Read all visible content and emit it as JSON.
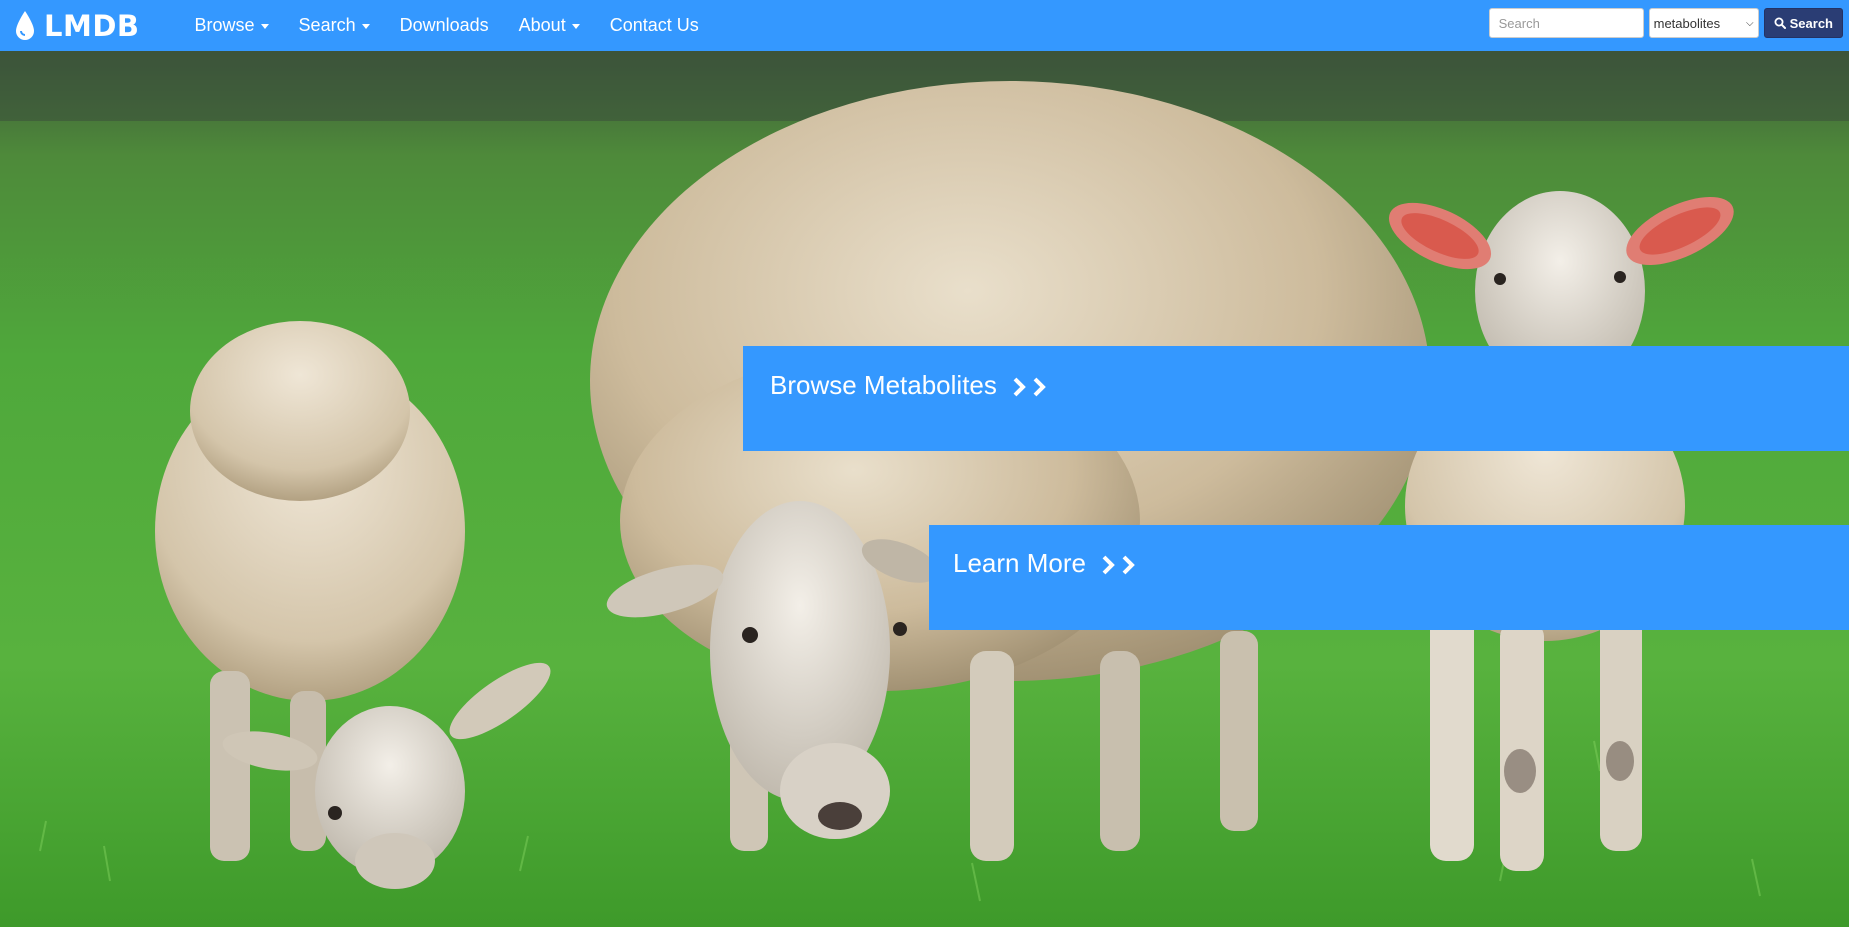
{
  "navbar": {
    "brand": "LMDB",
    "brand_icon": "droplet-icon",
    "items": [
      {
        "label": "Browse",
        "dropdown": true
      },
      {
        "label": "Search",
        "dropdown": true
      },
      {
        "label": "Downloads",
        "dropdown": false
      },
      {
        "label": "About",
        "dropdown": true
      },
      {
        "label": "Contact Us",
        "dropdown": false
      }
    ],
    "search": {
      "placeholder": "Search",
      "value": "",
      "selected_option": "metabolites",
      "button_label": "Search",
      "button_icon": "search-icon"
    },
    "colors": {
      "bar": "#3498ff",
      "search_button": "#2a3d74"
    }
  },
  "hero": {
    "image": "sheep-grazing-photo",
    "ctas": [
      {
        "label": "Browse Metabolites",
        "icon": "double-chevron-right-icon"
      },
      {
        "label": "Learn More",
        "icon": "double-chevron-right-icon"
      }
    ],
    "cta_color": "#3498ff"
  }
}
